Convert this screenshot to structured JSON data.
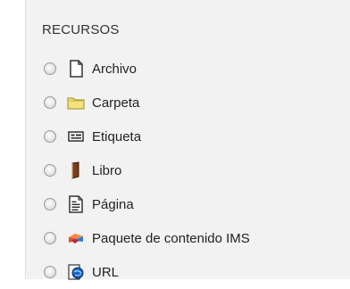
{
  "section": {
    "title": "RECURSOS"
  },
  "items": [
    {
      "label": "Archivo",
      "icon": "file-icon"
    },
    {
      "label": "Carpeta",
      "icon": "folder-icon"
    },
    {
      "label": "Etiqueta",
      "icon": "label-icon"
    },
    {
      "label": "Libro",
      "icon": "book-icon"
    },
    {
      "label": "Página",
      "icon": "page-icon"
    },
    {
      "label": "Paquete de contenido IMS",
      "icon": "ims-package-icon"
    },
    {
      "label": "URL",
      "icon": "url-globe-icon"
    }
  ],
  "colors": {
    "panel_background": "#f2f2f2",
    "text": "#222222",
    "folder": "#f6e27a",
    "book": "#7a3b1c",
    "ims_red": "#e24b3b",
    "ims_blue": "#2d7bd8"
  }
}
